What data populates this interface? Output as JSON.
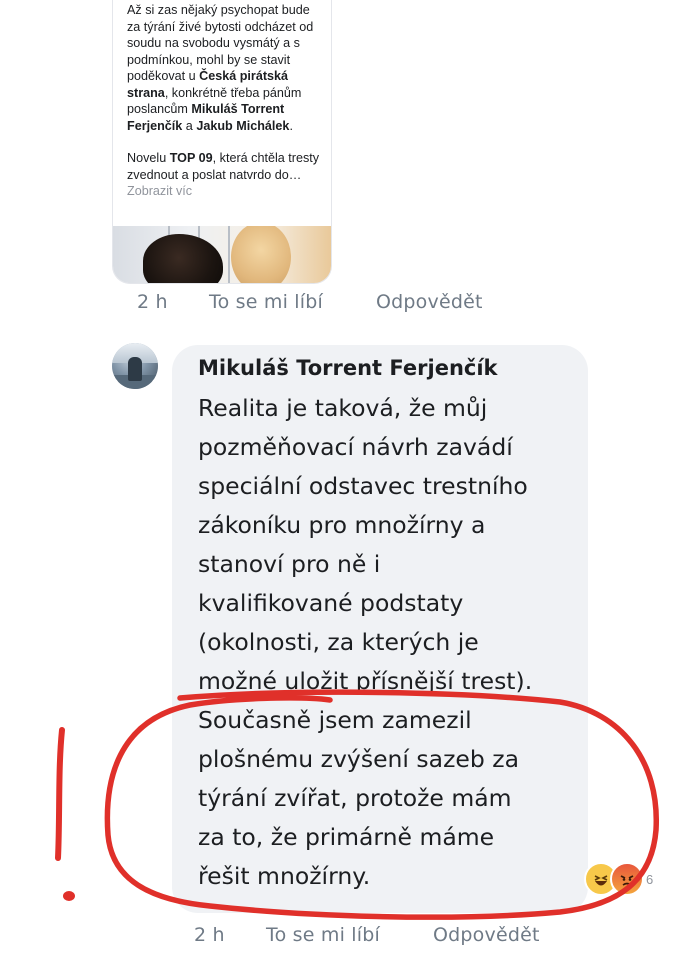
{
  "shared_post": {
    "para1_a": "Až si zas nějaký psychopat bude za týrání živé bytosti odcházet od soudu na svobodu vysmátý a s podmínkou, mohl by se stavit poděkovat u ",
    "party1": "Česká pirátská strana",
    "para1_b": ", konkrétně třeba pánům poslancům ",
    "person1": "Mikuláš Torrent Ferjenčík",
    "para1_c": " a ",
    "person2": "Jakub Michálek",
    "para1_d": ".",
    "para2_a": "Novelu ",
    "party2": "TOP 09",
    "para2_b": ", která chtěla tresty zvednout a poslat natvrdo do… ",
    "see_more": "Zobrazit víc"
  },
  "first_actions": {
    "time": "2 h",
    "like": "To se mi líbí",
    "reply": "Odpovědět"
  },
  "comment": {
    "author": "Mikuláš Torrent Ferjenčík",
    "lines": [
      "Realita je taková, že můj",
      "pozměňovací návrh zavádí",
      "speciální odstavec trestního",
      "zákoníku pro množírny a",
      "stanoví pro ně i",
      "kvalifikované podstaty",
      "(okolnosti, za kterých je",
      "možné uložit přísnější trest).",
      "Současně jsem zamezil",
      "plošnému zvýšení sazeb za",
      "týrání zvířat, protože mám",
      "za to, že primárně máme",
      "řešit množírny."
    ],
    "reaction_count": "6",
    "reactions": [
      "haha-icon",
      "angry-icon"
    ]
  },
  "second_actions": {
    "time": "2 h",
    "like": "To se mi líbí",
    "reply": "Odpovědět"
  },
  "colors": {
    "annotation": "#e0302a",
    "bubble": "#f0f2f5",
    "meta": "#6f7a86"
  }
}
